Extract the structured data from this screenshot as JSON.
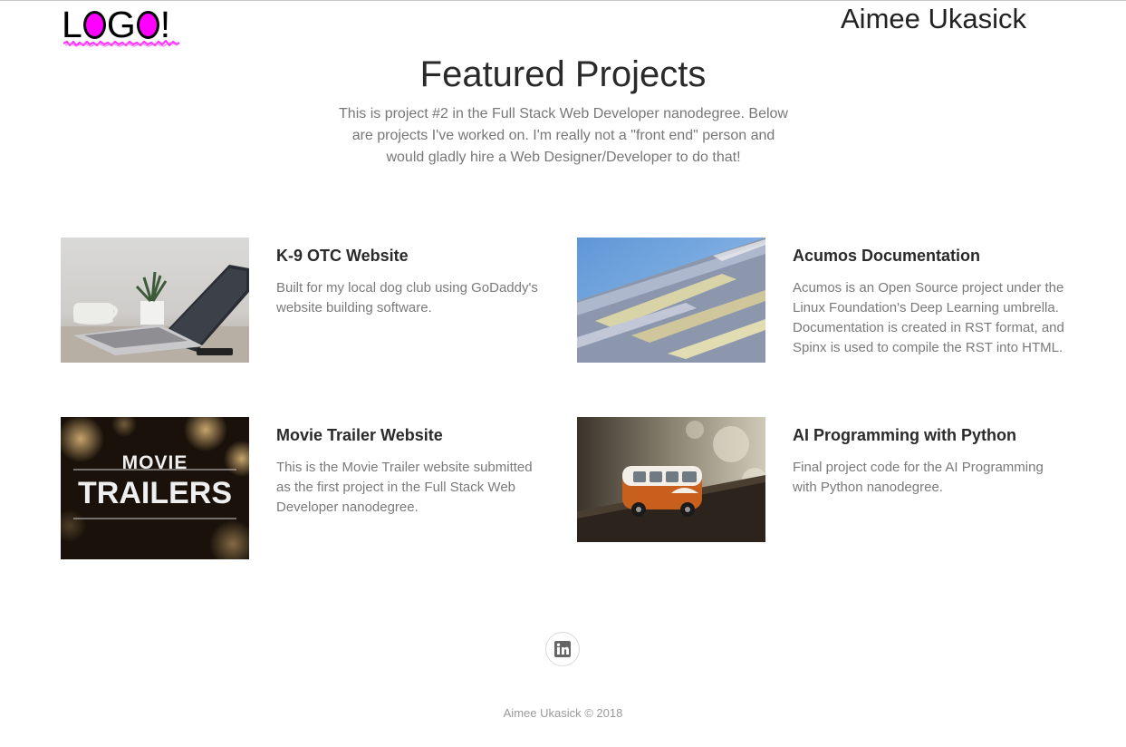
{
  "header": {
    "logo_text": "LOGO!",
    "owner_name": "Aimee Ukasick"
  },
  "hero": {
    "title": "Featured Projects",
    "intro": "This is project #2 in the Full Stack Web Developer nanodegree. Below are projects I've worked on. I'm really not a \"front end\" person and would gladly hire a Web Designer/Developer to do that!"
  },
  "projects": [
    {
      "title": "K-9 OTC Website",
      "description": "Built for my local dog club using GoDaddy's website building software.",
      "image": "laptop-desk-photo"
    },
    {
      "title": "Acumos Documentation",
      "description": "Acumos is an Open Source project under the Linux Foundation's Deep Learning umbrella. Documentation is created in RST format, and Spinx is used to compile the RST into HTML.",
      "image": "modern-building-photo"
    },
    {
      "title": "Movie Trailer Website",
      "description": "This is the Movie Trailer website submitted as the first project in the Full Stack Web Developer nanodegree.",
      "image": "movie-trailers-poster",
      "image_text": {
        "line1": "MOVIE",
        "line2": "TRAILERS"
      }
    },
    {
      "title": "AI Programming with Python",
      "description": "Final project code for the AI Programming with Python nanodegree.",
      "image": "toy-van-photo"
    }
  ],
  "footer": {
    "social_icon": "linkedin-icon",
    "copyright": "Aimee Ukasick © 2018"
  },
  "colors": {
    "logo_o_fill": "#ff00ff",
    "logo_squiggle": "#ff33ff",
    "title_text": "#2a2a2a",
    "body_text": "#7a7a7a",
    "footer_text": "#9a9a9a"
  }
}
